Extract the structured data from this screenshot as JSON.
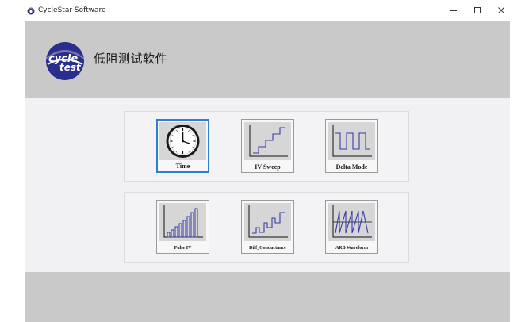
{
  "window": {
    "title": "CycleStar Software",
    "controls": [
      "minimize",
      "maximize",
      "close"
    ]
  },
  "header": {
    "logo_text_top": "cycle",
    "logo_text_bottom": "test",
    "title": "低阻测试软件"
  },
  "groups": [
    {
      "tiles": [
        {
          "label": "Time",
          "icon": "clock-icon",
          "selected": true
        },
        {
          "label": "IV Sweep",
          "icon": "staircase-icon",
          "selected": false
        },
        {
          "label": "Delta Mode",
          "icon": "square-wave-icon",
          "selected": false
        }
      ]
    },
    {
      "tiles": [
        {
          "label": "Pulse IV",
          "icon": "pulse-bars-icon",
          "selected": false
        },
        {
          "label": "Diff_Conductance",
          "icon": "diff-staircase-icon",
          "selected": false
        },
        {
          "label": "ARB Waveform",
          "icon": "arb-waveform-icon",
          "selected": false
        }
      ]
    }
  ],
  "colors": {
    "header_band": "#c9c9c9",
    "content_bg": "#f1f1f3",
    "selection_border": "#2f7fd0",
    "logo_blue": "#2a2f8c",
    "waveform_blue": "#3a3aa8"
  }
}
